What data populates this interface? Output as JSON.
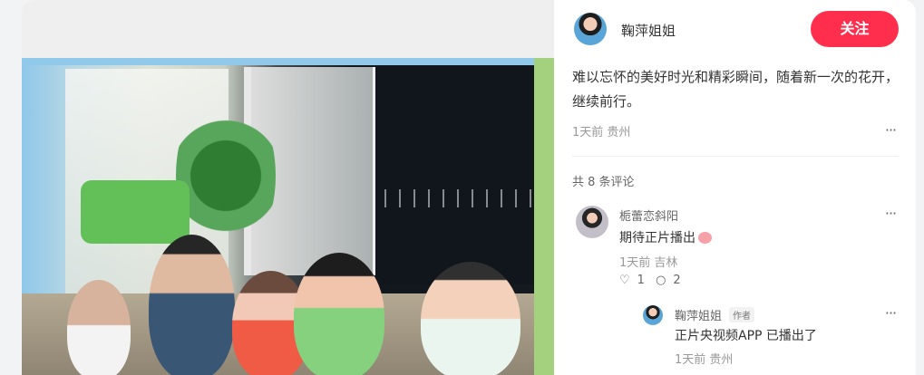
{
  "post": {
    "author": "鞠萍姐姐",
    "follow_label": "关注",
    "description": "难以忘怀的美好时光和精彩瞬间，随着新一次的花开，继续前行。",
    "meta": "1天前 贵州",
    "more_label": "···"
  },
  "comments": {
    "count_label": "共 8 条评论",
    "items": [
      {
        "name": "栀蕾恋斜阳",
        "text": "期待正片播出",
        "meta": "1天前 吉林",
        "likes": "1",
        "replies": "2"
      }
    ],
    "reply": {
      "name": "鞠萍姐姐",
      "badge": "作者",
      "text": "正片央视频APP 已播出了",
      "meta": "1天前 贵州"
    }
  },
  "icons": {
    "like": "♡",
    "comment": "○",
    "more": "···"
  },
  "colors": {
    "follow_button": "#ff2e4d"
  }
}
